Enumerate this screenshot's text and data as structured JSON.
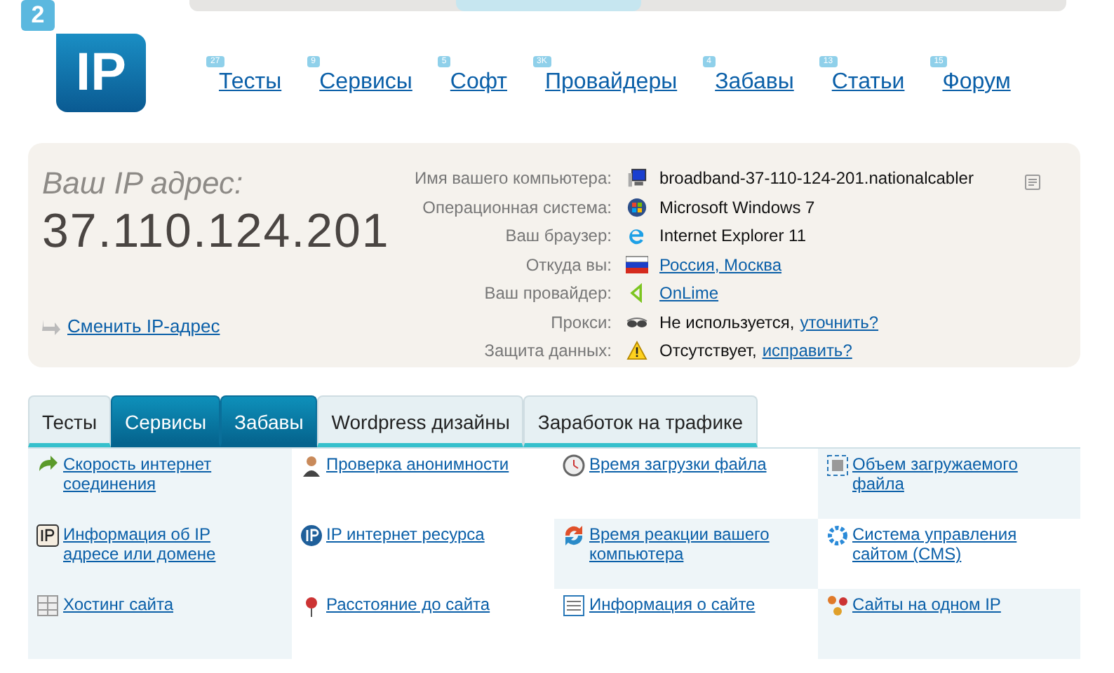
{
  "logo": {
    "badge": "2",
    "text": "IP"
  },
  "nav": [
    {
      "label": "Тесты",
      "count": "27"
    },
    {
      "label": "Сервисы",
      "count": "9"
    },
    {
      "label": "Софт",
      "count": "5"
    },
    {
      "label": "Провайдеры",
      "count": "3K"
    },
    {
      "label": "Забавы",
      "count": "4"
    },
    {
      "label": "Статьи",
      "count": "13"
    },
    {
      "label": "Форум",
      "count": "15"
    }
  ],
  "ip_panel": {
    "heading": "Ваш IP адрес:",
    "ip": "37.110.124.201",
    "change_link": "Сменить IP-адрес",
    "details": [
      {
        "kind": "computer",
        "label": "Имя вашего компьютера:",
        "value": "broadband-37-110-124-201.nationalcabler"
      },
      {
        "kind": "os",
        "label": "Операционная система:",
        "value": "Microsoft Windows 7"
      },
      {
        "kind": "browser",
        "label": "Ваш браузер:",
        "value": "Internet Explorer 11"
      },
      {
        "kind": "flag",
        "label": "Откуда вы:",
        "link": "Россия, Москва"
      },
      {
        "kind": "provider",
        "label": "Ваш провайдер:",
        "link": "OnLime"
      },
      {
        "kind": "proxy",
        "label": "Прокси:",
        "value": "Не используется,",
        "link": "уточнить?"
      },
      {
        "kind": "warning",
        "label": "Защита данных:",
        "value": "Отсутствует,",
        "link": "исправить?"
      }
    ]
  },
  "tabs": [
    {
      "label": "Тесты",
      "selected": false
    },
    {
      "label": "Сервисы",
      "selected": true
    },
    {
      "label": "Забавы",
      "selected": true
    },
    {
      "label": "Wordpress дизайны",
      "selected": false
    },
    {
      "label": "Заработок на трафике",
      "selected": false
    }
  ],
  "services": [
    {
      "kind": "arrow",
      "label": "Скорость интернет соединения"
    },
    {
      "kind": "person",
      "label": "Проверка анонимности"
    },
    {
      "kind": "clock",
      "label": "Время загрузки файла"
    },
    {
      "kind": "frame",
      "label": "Объем загружаемого файла"
    },
    {
      "kind": "ip",
      "label": "Информация об IP адресе или домене"
    },
    {
      "kind": "globe",
      "label": "IP интернет ресурса"
    },
    {
      "kind": "sync",
      "label": "Время реакции вашего компьютера"
    },
    {
      "kind": "gear",
      "label": "Система управления сайтом (CMS)"
    },
    {
      "kind": "server",
      "label": "Хостинг сайта"
    },
    {
      "kind": "pin",
      "label": "Расстояние до сайта"
    },
    {
      "kind": "doc",
      "label": "Информация о сайте"
    },
    {
      "kind": "network",
      "label": "Сайты на одном IP"
    }
  ]
}
